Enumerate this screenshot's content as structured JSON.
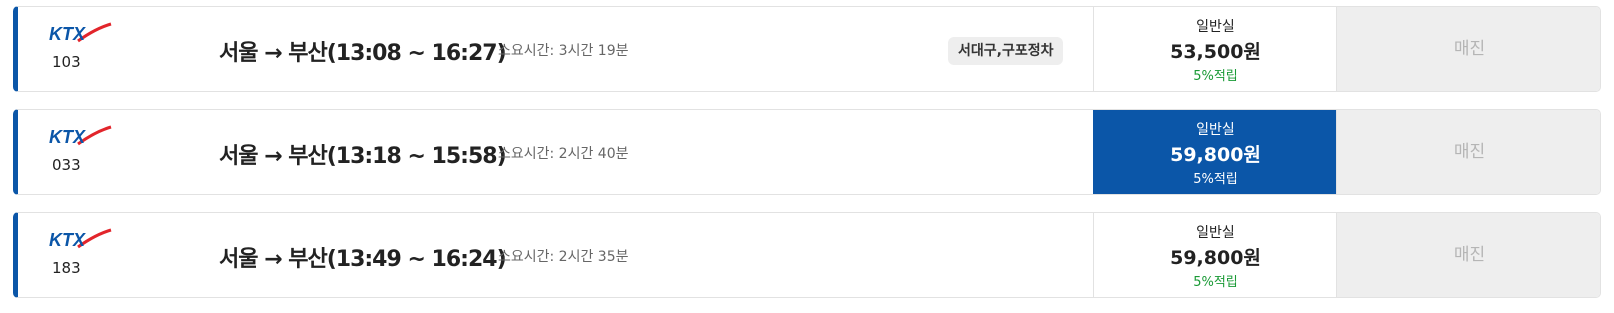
{
  "trains": [
    {
      "brand": "KTX",
      "number": "103",
      "route": "서울 → 부산(13:08 ~ 16:27)",
      "duration": "소요시간: 3시간 19분",
      "stops": "서대구,구포정차",
      "fare": {
        "class": "일반실",
        "price": "53,500원",
        "points": "5%적립"
      },
      "special": "매진"
    },
    {
      "brand": "KTX",
      "number": "033",
      "route": "서울 → 부산(13:18 ~ 15:58)",
      "duration": "소요시간: 2시간 40분",
      "stops": "",
      "fare": {
        "class": "일반실",
        "price": "59,800원",
        "points": "5%적립"
      },
      "special": "매진"
    },
    {
      "brand": "KTX",
      "number": "183",
      "route": "서울 → 부산(13:49 ~ 16:24)",
      "duration": "소요시간: 2시간 35분",
      "stops": "",
      "fare": {
        "class": "일반실",
        "price": "59,800원",
        "points": "5%적립"
      },
      "special": "매진"
    }
  ],
  "colors": {
    "brand_blue": "#0b56a8",
    "points_green": "#1a9a36",
    "ktx_red": "#e2252b",
    "soldout_gray": "#b5b5b5"
  },
  "icons": {
    "logo": "ktx-logo-icon"
  }
}
